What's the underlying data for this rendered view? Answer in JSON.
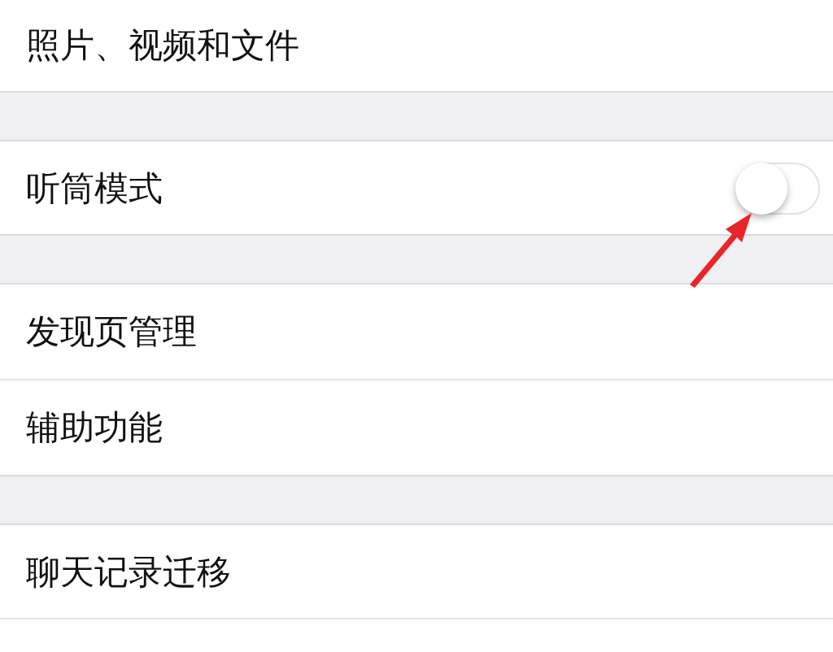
{
  "sections": [
    {
      "rows": [
        {
          "kind": "plain",
          "label": "照片、视频和文件"
        }
      ]
    },
    {
      "rows": [
        {
          "kind": "toggle",
          "label": "听筒模式",
          "on": false
        }
      ]
    },
    {
      "rows": [
        {
          "kind": "plain",
          "label": "发现页管理"
        },
        {
          "kind": "plain",
          "label": "辅助功能"
        }
      ]
    },
    {
      "rows": [
        {
          "kind": "plain",
          "label": "聊天记录迁移"
        },
        {
          "kind": "blank"
        }
      ]
    }
  ],
  "annotation": {
    "kind": "arrow"
  }
}
